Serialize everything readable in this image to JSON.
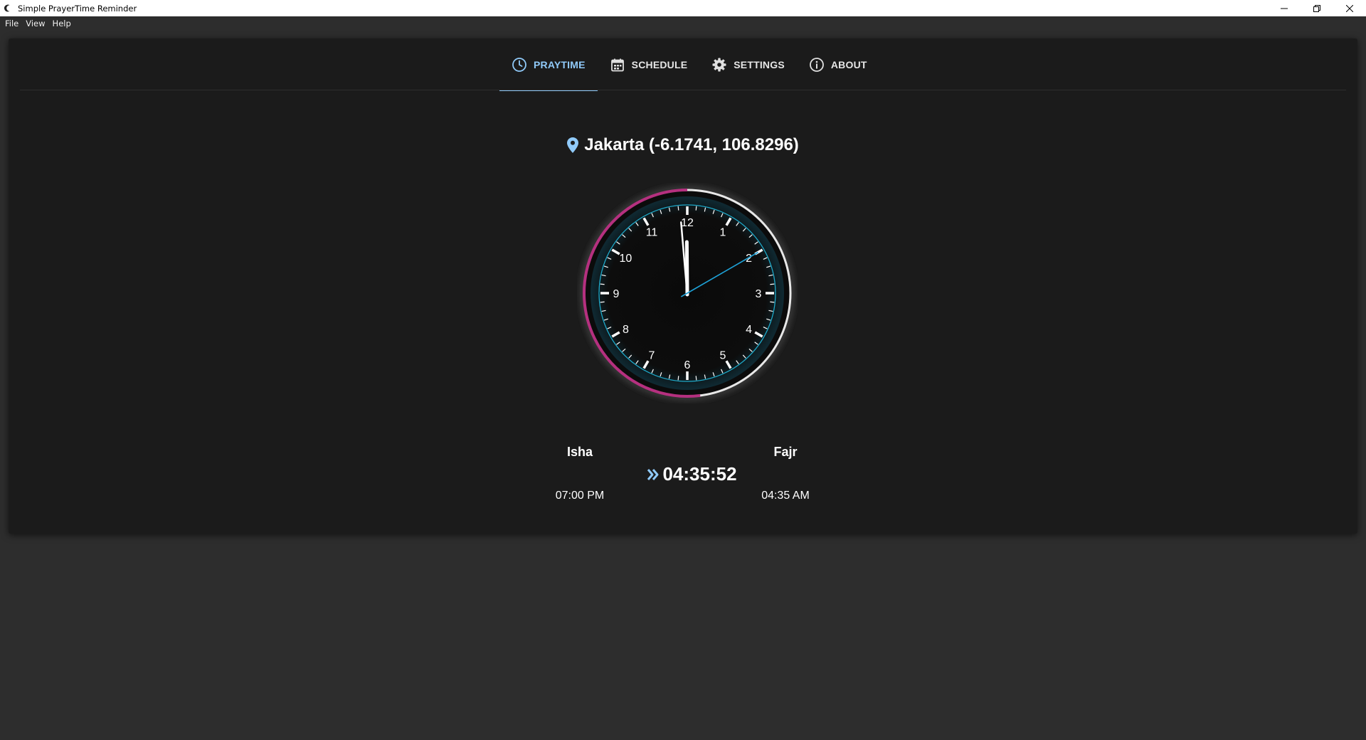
{
  "window": {
    "title": "Simple PrayerTime Reminder"
  },
  "menu": [
    "File",
    "View",
    "Help"
  ],
  "tabs": [
    {
      "label": "PRAYTIME",
      "icon": "clock-icon",
      "active": true
    },
    {
      "label": "SCHEDULE",
      "icon": "calendar-icon",
      "active": false
    },
    {
      "label": "SETTINGS",
      "icon": "gear-icon",
      "active": false
    },
    {
      "label": "ABOUT",
      "icon": "info-icon",
      "active": false
    }
  ],
  "location": {
    "text": "Jakarta (-6.1741, 106.8296)",
    "icon": "map-pin-icon"
  },
  "clock": {
    "numbers": [
      "12",
      "1",
      "2",
      "3",
      "4",
      "5",
      "6",
      "7",
      "8",
      "9",
      "10",
      "11"
    ],
    "time": {
      "hour": 11,
      "minute": 59,
      "second": 10
    },
    "progress_fraction": 0.52,
    "progress_color": "#b5307f",
    "second_hand_color": "#1ea1d6",
    "inner_ring_color": "#1ea9c9"
  },
  "previous_prayer": {
    "name": "Isha",
    "time": "07:00 PM"
  },
  "next_prayer": {
    "name": "Fajr",
    "time": "04:35 AM"
  },
  "countdown": {
    "value": "04:35:52",
    "icon": "double-chevron-right-icon"
  },
  "colors": {
    "accent": "#90caf9",
    "card_bg": "#1b1b1b",
    "page_bg": "#2d2d2d"
  }
}
